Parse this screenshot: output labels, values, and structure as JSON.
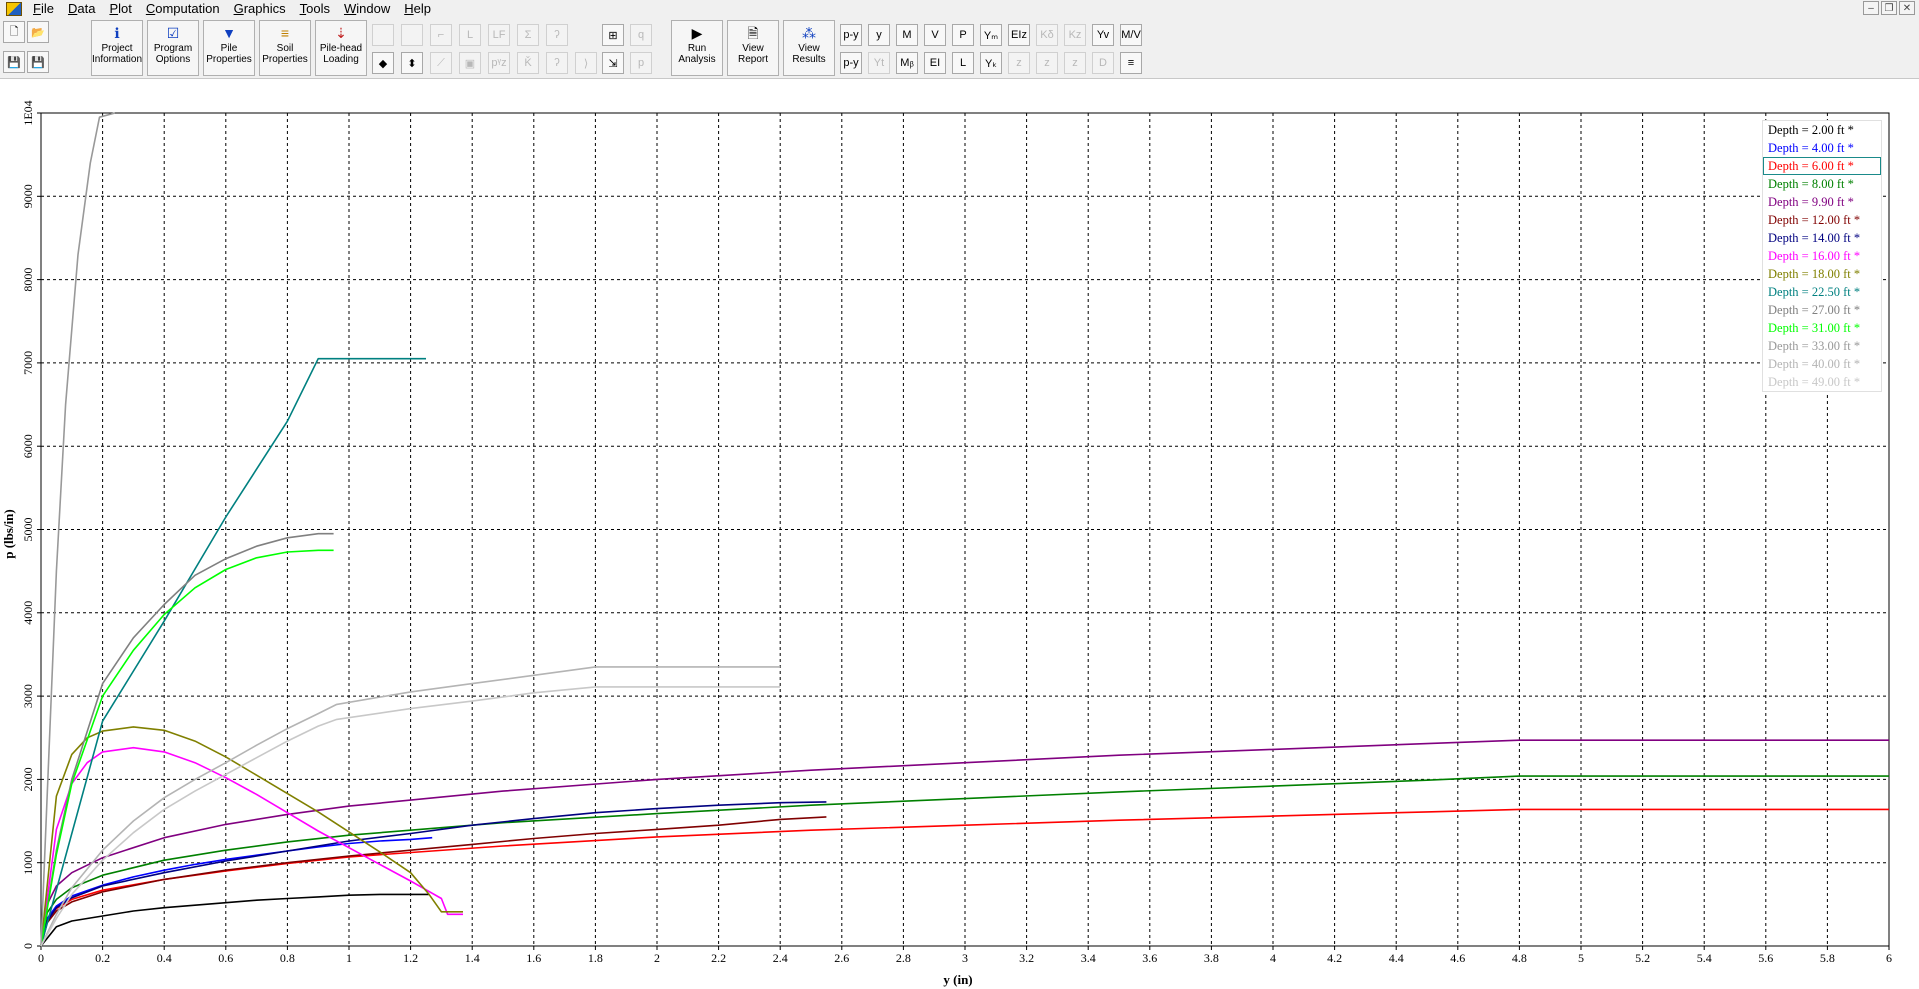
{
  "menubar": {
    "items": [
      "File",
      "Data",
      "Plot",
      "Computation",
      "Graphics",
      "Tools",
      "Window",
      "Help"
    ],
    "window_controls": [
      "–",
      "❐",
      "✕"
    ]
  },
  "toolbar": {
    "big_buttons": [
      {
        "label_1": "Project",
        "label_2": "Information",
        "icon": "info-icon",
        "glyph": "ℹ",
        "color": "#1040c0"
      },
      {
        "label_1": "Program",
        "label_2": "Options",
        "icon": "checkbox-icon",
        "glyph": "☑",
        "color": "#1040c0"
      },
      {
        "label_1": "Pile",
        "label_2": "Properties",
        "icon": "pile-icon",
        "glyph": "▼",
        "color": "#1040c0"
      },
      {
        "label_1": "Soil",
        "label_2": "Properties",
        "icon": "soil-layers-icon",
        "glyph": "≡",
        "color": "#c08000"
      },
      {
        "label_1": "Pile-head",
        "label_2": "Loading",
        "icon": "pile-load-icon",
        "glyph": "⇣",
        "color": "#c02020"
      },
      {
        "label_1": "Run",
        "label_2": "Analysis",
        "icon": "play-icon",
        "glyph": "▶",
        "color": "#000000"
      },
      {
        "label_1": "View",
        "label_2": "Report",
        "icon": "report-icon",
        "glyph": "🗎",
        "color": "#000000"
      },
      {
        "label_1": "View",
        "label_2": "Results",
        "icon": "results-grid-icon",
        "glyph": "⁂",
        "color": "#1040c0"
      }
    ],
    "small_left": [
      {
        "name": "new-file-icon",
        "glyph": "🗋"
      },
      {
        "name": "open-folder-icon",
        "glyph": "📂"
      },
      {
        "name": "save-icon",
        "glyph": "💾"
      },
      {
        "name": "save-all-icon",
        "glyph": "💾"
      }
    ],
    "graphics_row1": [
      "",
      "",
      "⌐",
      "L",
      "LF",
      "Σ",
      "ʔ"
    ],
    "graphics_row2": [
      "◆",
      "⬍",
      "⟋",
      "▣",
      "pᵞz",
      "Ǩ",
      "ʔ",
      "⟩"
    ],
    "mid_row1": [
      "⊞",
      "q"
    ],
    "mid_row2": [
      "⇲",
      "p"
    ],
    "plot_row1": [
      "p-y",
      "y",
      "M",
      "V",
      "P",
      "Yₘ",
      "EIz",
      "Kδ",
      "Kz",
      "Yv",
      "M/V"
    ],
    "plot_row2": [
      "p-y",
      "Yt",
      "Mᵦ",
      "EI",
      "L",
      "Yₖ",
      "z",
      "z",
      "z",
      "D",
      "≡"
    ]
  },
  "chart_data": {
    "type": "line",
    "xlabel": "y (in)",
    "ylabel": "p (lbs/in)",
    "xlim": [
      0,
      6
    ],
    "ylim": [
      0,
      10000
    ],
    "x_ticks": [
      "0",
      "0.2",
      "0.4",
      "0.6",
      "0.8",
      "1",
      "1.2",
      "1.4",
      "1.6",
      "1.8",
      "2",
      "2.2",
      "2.4",
      "2.6",
      "2.8",
      "3",
      "3.2",
      "3.4",
      "3.6",
      "3.8",
      "4",
      "4.2",
      "4.4",
      "4.6",
      "4.8",
      "5",
      "5.2",
      "5.4",
      "5.6",
      "5.8",
      "6"
    ],
    "y_ticks": [
      "0",
      "1000",
      "2000",
      "3000",
      "4000",
      "5000",
      "6000",
      "7000",
      "8000",
      "9000",
      "1E04"
    ],
    "grid": true,
    "legend_position": "top-right",
    "selected_legend_index": 2,
    "series": [
      {
        "name": "Depth = 2.00 ft *",
        "color": "#000000",
        "points": [
          [
            0,
            0
          ],
          [
            0.05,
            230
          ],
          [
            0.1,
            300
          ],
          [
            0.2,
            360
          ],
          [
            0.3,
            420
          ],
          [
            0.4,
            460
          ],
          [
            0.5,
            490
          ],
          [
            0.6,
            520
          ],
          [
            0.7,
            550
          ],
          [
            0.8,
            570
          ],
          [
            0.9,
            590
          ],
          [
            1.0,
            610
          ],
          [
            1.1,
            620
          ],
          [
            1.2,
            620
          ],
          [
            1.26,
            620
          ]
        ]
      },
      {
        "name": "Depth = 4.00 ft *",
        "color": "#0000ff",
        "points": [
          [
            0,
            0
          ],
          [
            0.02,
            330
          ],
          [
            0.05,
            480
          ],
          [
            0.1,
            600
          ],
          [
            0.2,
            730
          ],
          [
            0.3,
            830
          ],
          [
            0.4,
            910
          ],
          [
            0.5,
            980
          ],
          [
            0.6,
            1040
          ],
          [
            0.7,
            1090
          ],
          [
            0.8,
            1140
          ],
          [
            0.9,
            1190
          ],
          [
            1.0,
            1230
          ],
          [
            1.1,
            1260
          ],
          [
            1.2,
            1280
          ],
          [
            1.27,
            1300
          ]
        ]
      },
      {
        "name": "Depth = 6.00 ft *",
        "color": "#ff0000",
        "points": [
          [
            0,
            0
          ],
          [
            0.02,
            300
          ],
          [
            0.05,
            450
          ],
          [
            0.1,
            560
          ],
          [
            0.2,
            670
          ],
          [
            0.4,
            800
          ],
          [
            0.6,
            900
          ],
          [
            0.8,
            990
          ],
          [
            1.0,
            1070
          ],
          [
            1.5,
            1200
          ],
          [
            2.0,
            1310
          ],
          [
            2.5,
            1390
          ],
          [
            3.0,
            1450
          ],
          [
            3.5,
            1510
          ],
          [
            4.0,
            1560
          ],
          [
            4.5,
            1610
          ],
          [
            4.8,
            1640
          ],
          [
            6.0,
            1640
          ]
        ]
      },
      {
        "name": "Depth = 8.00 ft *",
        "color": "#008000",
        "points": [
          [
            0,
            0
          ],
          [
            0.02,
            400
          ],
          [
            0.05,
            560
          ],
          [
            0.1,
            700
          ],
          [
            0.2,
            850
          ],
          [
            0.4,
            1030
          ],
          [
            0.6,
            1150
          ],
          [
            0.8,
            1250
          ],
          [
            1.0,
            1330
          ],
          [
            1.5,
            1480
          ],
          [
            2.0,
            1590
          ],
          [
            2.5,
            1690
          ],
          [
            3.0,
            1770
          ],
          [
            3.5,
            1850
          ],
          [
            4.0,
            1920
          ],
          [
            4.5,
            1990
          ],
          [
            4.8,
            2040
          ],
          [
            6.0,
            2040
          ]
        ]
      },
      {
        "name": "Depth = 9.90 ft *",
        "color": "#800080",
        "points": [
          [
            0,
            0
          ],
          [
            0.02,
            500
          ],
          [
            0.05,
            720
          ],
          [
            0.1,
            880
          ],
          [
            0.2,
            1060
          ],
          [
            0.4,
            1300
          ],
          [
            0.6,
            1460
          ],
          [
            0.8,
            1580
          ],
          [
            1.0,
            1680
          ],
          [
            1.5,
            1860
          ],
          [
            2.0,
            2000
          ],
          [
            2.5,
            2110
          ],
          [
            3.0,
            2200
          ],
          [
            3.5,
            2290
          ],
          [
            4.0,
            2360
          ],
          [
            4.5,
            2430
          ],
          [
            4.8,
            2470
          ],
          [
            6.0,
            2470
          ]
        ]
      },
      {
        "name": "Depth = 12.00 ft *",
        "color": "#800000",
        "points": [
          [
            0,
            0
          ],
          [
            0.02,
            280
          ],
          [
            0.05,
            420
          ],
          [
            0.1,
            530
          ],
          [
            0.2,
            650
          ],
          [
            0.4,
            800
          ],
          [
            0.6,
            910
          ],
          [
            0.8,
            1000
          ],
          [
            1.0,
            1080
          ],
          [
            1.2,
            1150
          ],
          [
            1.4,
            1220
          ],
          [
            1.6,
            1290
          ],
          [
            1.8,
            1350
          ],
          [
            2.0,
            1400
          ],
          [
            2.2,
            1450
          ],
          [
            2.4,
            1520
          ],
          [
            2.55,
            1550
          ]
        ]
      },
      {
        "name": "Depth = 14.00 ft *",
        "color": "#000080",
        "points": [
          [
            0,
            0
          ],
          [
            0.02,
            300
          ],
          [
            0.05,
            460
          ],
          [
            0.1,
            580
          ],
          [
            0.2,
            720
          ],
          [
            0.4,
            880
          ],
          [
            0.6,
            1020
          ],
          [
            0.8,
            1140
          ],
          [
            1.0,
            1260
          ],
          [
            1.2,
            1350
          ],
          [
            1.4,
            1450
          ],
          [
            1.6,
            1530
          ],
          [
            1.8,
            1600
          ],
          [
            2.0,
            1650
          ],
          [
            2.2,
            1690
          ],
          [
            2.4,
            1720
          ],
          [
            2.55,
            1730
          ]
        ]
      },
      {
        "name": "Depth = 16.00 ft *",
        "color": "#ff00ff",
        "points": [
          [
            0,
            0
          ],
          [
            0.05,
            1400
          ],
          [
            0.1,
            1950
          ],
          [
            0.15,
            2200
          ],
          [
            0.2,
            2330
          ],
          [
            0.3,
            2380
          ],
          [
            0.4,
            2330
          ],
          [
            0.5,
            2200
          ],
          [
            0.6,
            2020
          ],
          [
            0.7,
            1820
          ],
          [
            0.8,
            1600
          ],
          [
            0.9,
            1380
          ],
          [
            1.0,
            1180
          ],
          [
            1.1,
            980
          ],
          [
            1.2,
            780
          ],
          [
            1.3,
            570
          ],
          [
            1.32,
            380
          ],
          [
            1.37,
            380
          ]
        ]
      },
      {
        "name": "Depth = 18.00 ft *",
        "color": "#808000",
        "points": [
          [
            0,
            0
          ],
          [
            0.05,
            1800
          ],
          [
            0.1,
            2300
          ],
          [
            0.15,
            2500
          ],
          [
            0.2,
            2580
          ],
          [
            0.3,
            2630
          ],
          [
            0.4,
            2590
          ],
          [
            0.5,
            2460
          ],
          [
            0.6,
            2270
          ],
          [
            0.7,
            2050
          ],
          [
            0.8,
            1830
          ],
          [
            0.9,
            1610
          ],
          [
            1.0,
            1370
          ],
          [
            1.1,
            1130
          ],
          [
            1.2,
            880
          ],
          [
            1.26,
            620
          ],
          [
            1.3,
            410
          ],
          [
            1.37,
            410
          ]
        ]
      },
      {
        "name": "Depth = 22.50 ft *",
        "color": "#008080",
        "points": [
          [
            0,
            0
          ],
          [
            0.2,
            2700
          ],
          [
            0.4,
            3900
          ],
          [
            0.6,
            5150
          ],
          [
            0.8,
            6300
          ],
          [
            0.9,
            7050
          ],
          [
            1.25,
            7050
          ]
        ]
      },
      {
        "name": "Depth = 27.00 ft *",
        "color": "#808080",
        "points": [
          [
            0,
            0
          ],
          [
            0.05,
            1150
          ],
          [
            0.1,
            2000
          ],
          [
            0.2,
            3150
          ],
          [
            0.3,
            3700
          ],
          [
            0.4,
            4100
          ],
          [
            0.5,
            4450
          ],
          [
            0.6,
            4650
          ],
          [
            0.7,
            4800
          ],
          [
            0.8,
            4900
          ],
          [
            0.9,
            4950
          ],
          [
            0.95,
            4950
          ]
        ]
      },
      {
        "name": "Depth = 31.00 ft *",
        "color": "#00ff00",
        "points": [
          [
            0,
            0
          ],
          [
            0.05,
            1100
          ],
          [
            0.1,
            1950
          ],
          [
            0.2,
            3000
          ],
          [
            0.3,
            3550
          ],
          [
            0.4,
            3980
          ],
          [
            0.5,
            4300
          ],
          [
            0.6,
            4520
          ],
          [
            0.7,
            4660
          ],
          [
            0.8,
            4730
          ],
          [
            0.9,
            4750
          ],
          [
            0.95,
            4750
          ]
        ]
      },
      {
        "name": "Depth = 33.00 ft *",
        "color": "#999999",
        "points": [
          [
            0,
            0
          ],
          [
            0.05,
            4500
          ],
          [
            0.08,
            6500
          ],
          [
            0.12,
            8300
          ],
          [
            0.16,
            9400
          ],
          [
            0.19,
            9950
          ],
          [
            0.24,
            10000
          ]
        ]
      },
      {
        "name": "Depth = 40.00 ft *",
        "color": "#b4b4b4",
        "points": [
          [
            0,
            0
          ],
          [
            0.05,
            380
          ],
          [
            0.1,
            700
          ],
          [
            0.2,
            1150
          ],
          [
            0.3,
            1500
          ],
          [
            0.4,
            1780
          ],
          [
            0.5,
            2000
          ],
          [
            0.6,
            2200
          ],
          [
            0.7,
            2410
          ],
          [
            0.8,
            2610
          ],
          [
            0.9,
            2790
          ],
          [
            0.96,
            2900
          ],
          [
            1.2,
            3050
          ],
          [
            1.4,
            3150
          ],
          [
            1.6,
            3250
          ],
          [
            1.8,
            3350
          ],
          [
            2.4,
            3350
          ]
        ]
      },
      {
        "name": "Depth = 49.00 ft *",
        "color": "#c8c8c8",
        "points": [
          [
            0,
            0
          ],
          [
            0.05,
            330
          ],
          [
            0.1,
            620
          ],
          [
            0.2,
            1030
          ],
          [
            0.3,
            1360
          ],
          [
            0.4,
            1640
          ],
          [
            0.5,
            1860
          ],
          [
            0.6,
            2060
          ],
          [
            0.7,
            2260
          ],
          [
            0.8,
            2460
          ],
          [
            0.9,
            2640
          ],
          [
            0.96,
            2720
          ],
          [
            1.2,
            2850
          ],
          [
            1.4,
            2940
          ],
          [
            1.6,
            3040
          ],
          [
            1.8,
            3110
          ],
          [
            2.4,
            3110
          ]
        ]
      }
    ]
  }
}
